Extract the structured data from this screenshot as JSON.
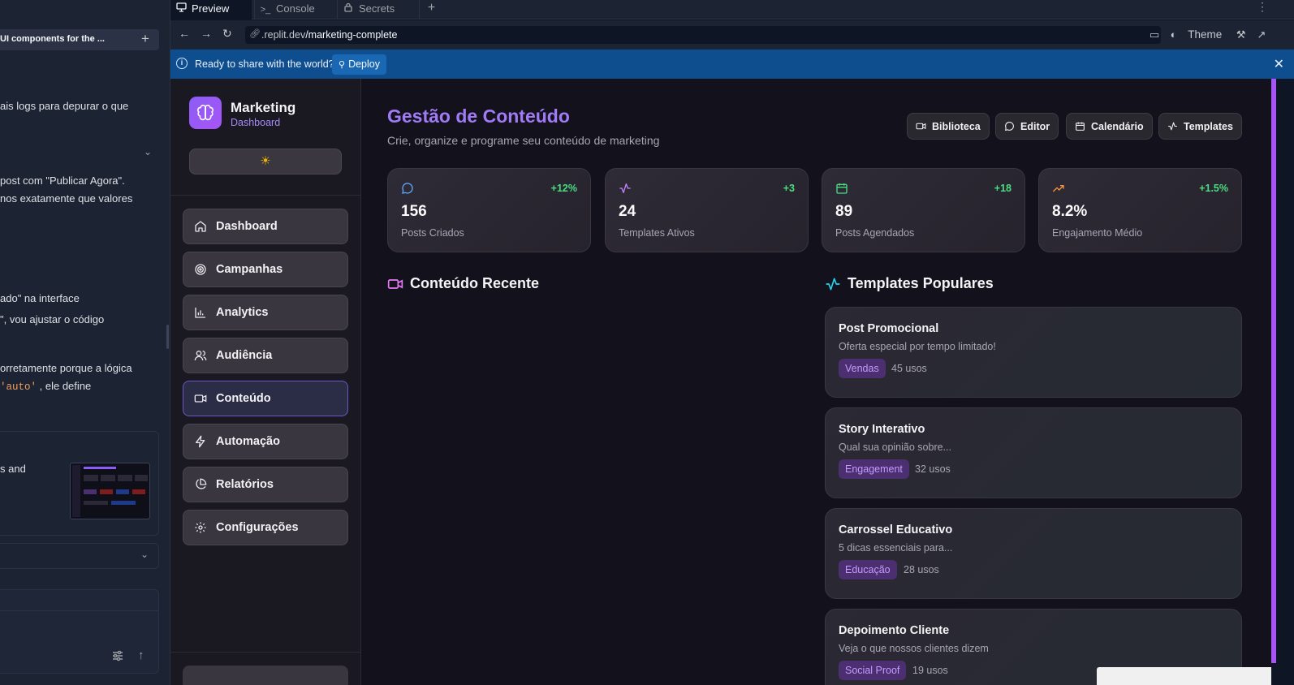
{
  "chat": {
    "header": "UI components for the ...",
    "lines": [
      "ais logs para depurar o que",
      "post com \"Publicar Agora\".",
      "nos exatamente que valores",
      "ado\" na interface",
      "\", vou ajustar o código",
      "orretamente porque a lógica",
      ", ele define",
      "s and"
    ],
    "code_snippet": "'auto'"
  },
  "tabs": [
    {
      "label": "Preview",
      "icon": "monitor-icon"
    },
    {
      "label": "Console",
      "icon": "terminal-icon"
    },
    {
      "label": "Secrets",
      "icon": "lock-icon"
    }
  ],
  "url": {
    "host": ".replit.dev",
    "path": "/marketing-complete"
  },
  "toolbar": {
    "theme_label": "Theme"
  },
  "banner": {
    "text": "Ready to share with the world?",
    "deploy_label": "Deploy"
  },
  "sidebar": {
    "brand": "Marketing",
    "brand_sub": "Dashboard",
    "items": [
      {
        "label": "Dashboard",
        "icon": "home-icon"
      },
      {
        "label": "Campanhas",
        "icon": "target-icon"
      },
      {
        "label": "Analytics",
        "icon": "bar-chart-icon"
      },
      {
        "label": "Audiência",
        "icon": "users-icon"
      },
      {
        "label": "Conteúdo",
        "icon": "video-icon",
        "active": true
      },
      {
        "label": "Automação",
        "icon": "zap-icon"
      },
      {
        "label": "Relatórios",
        "icon": "pie-chart-icon"
      },
      {
        "label": "Configurações",
        "icon": "settings-icon"
      }
    ]
  },
  "main": {
    "title": "Gestão de Conteúdo",
    "subtitle": "Crie, organize e programe seu conteúdo de marketing",
    "buttons": [
      {
        "label": "Biblioteca",
        "icon": "video-icon"
      },
      {
        "label": "Editor",
        "icon": "message-icon"
      },
      {
        "label": "Calendário",
        "icon": "calendar-icon"
      },
      {
        "label": "Templates",
        "icon": "activity-icon"
      }
    ],
    "stats": [
      {
        "value": "156",
        "label": "Posts Criados",
        "change": "+12%",
        "icon": "message-icon",
        "color": "#60a5fa"
      },
      {
        "value": "24",
        "label": "Templates Ativos",
        "change": "+3",
        "icon": "activity-icon",
        "color": "#c084fc"
      },
      {
        "value": "89",
        "label": "Posts Agendados",
        "change": "+18",
        "icon": "calendar-icon",
        "color": "#4ade80"
      },
      {
        "value": "8.2%",
        "label": "Engajamento Médio",
        "change": "+1.5%",
        "icon": "trending-up-icon",
        "color": "#fb923c"
      }
    ],
    "recent_title": "Conteúdo Recente",
    "popular_title": "Templates Populares",
    "templates": [
      {
        "name": "Post Promocional",
        "desc": "Oferta especial por tempo limitado!",
        "tag": "Vendas",
        "uses": "45 usos"
      },
      {
        "name": "Story Interativo",
        "desc": "Qual sua opinião sobre...",
        "tag": "Engagement",
        "uses": "32 usos"
      },
      {
        "name": "Carrossel Educativo",
        "desc": "5 dicas essenciais para...",
        "tag": "Educação",
        "uses": "28 usos"
      },
      {
        "name": "Depoimento Cliente",
        "desc": "Veja o que nossos clientes dizem",
        "tag": "Social Proof",
        "uses": "19 usos"
      }
    ]
  }
}
